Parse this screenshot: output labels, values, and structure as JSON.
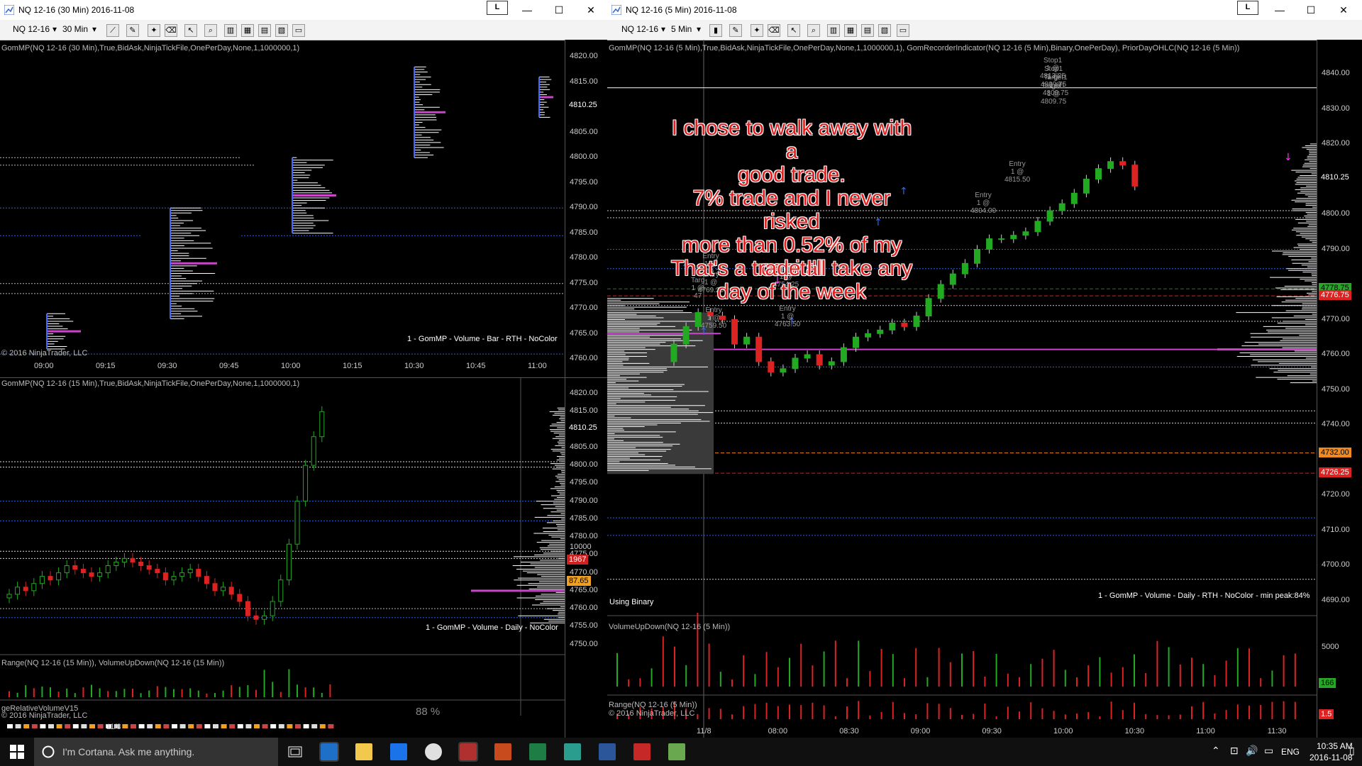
{
  "left_window": {
    "title": "NQ 12-16 (30 Min)  2016-11-08",
    "lock_label": "L",
    "toolbar": {
      "instrument": "NQ 12-16",
      "interval": "30 Min"
    },
    "top_panel": {
      "indicator_text": "GomMP(NQ 12-16 (30 Min),True,BidAsk,NinjaTickFile,OnePerDay,None,1,1000000,1)",
      "legend": "1 - GomMP  - Volume - Bar - RTH - NoColor",
      "copyright": "© 2016 NinjaTrader, LLC",
      "price_ticks": [
        "4820.00",
        "4815.00",
        "4805.00",
        "4800.00",
        "4795.00",
        "4790.00",
        "4785.00",
        "4780.00",
        "4775.00",
        "4770.00",
        "4765.00",
        "4760.00"
      ],
      "last_price": "4810.25",
      "time_ticks": [
        "09:00",
        "09:15",
        "09:30",
        "09:45",
        "10:00",
        "10:15",
        "10:30",
        "10:45",
        "11:00"
      ]
    },
    "bottom_panel": {
      "indicator_text": "GomMP(NQ 12-16 (15 Min),True,BidAsk,NinjaTickFile,OnePerDay,None,1,1000000,1)",
      "legend": "1 - GomMP  - Volume - Daily - NoColor",
      "price_ticks": [
        "4820.00",
        "4815.00",
        "4805.00",
        "4800.00",
        "4795.00",
        "4790.00",
        "4785.00",
        "4780.00",
        "4775.00",
        "4770.00",
        "4765.00",
        "4760.00",
        "4755.00",
        "4750.00"
      ],
      "last_price": "4810.25",
      "volume_label": "Range(NQ 12-16 (15 Min)), VolumeUpDown(NQ 12-16 (15 Min))",
      "volume_tick": "10000",
      "volume_tag": "1967",
      "relvol_label": "geRelativeVolumeV15",
      "relvol_copyright": "© 2016 NinjaTrader, LLC",
      "relvol_pct": "88 %",
      "relvol_tag": "87.65",
      "date_tick": "11/8"
    }
  },
  "right_window": {
    "title": "NQ 12-16 (5 Min)  2016-11-08",
    "lock_label": "L",
    "toolbar": {
      "instrument": "NQ 12-16",
      "interval": "5 Min"
    },
    "main_panel": {
      "indicator_text": "GomMP(NQ 12-16 (5 Min),True,BidAsk,NinjaTickFile,OnePerDay,None,1,1000000,1), GomRecorderIndicator(NQ 12-16 (5 Min),Binary,OnePerDay), PriorDayOHLC(NQ 12-16 (5 Min))",
      "price_ticks": [
        "4840.00",
        "4830.00",
        "4820.00",
        "4810.25",
        "4800.00",
        "4790.00",
        "4778.75",
        "4776.75",
        "4770.00",
        "4760.00",
        "4750.00",
        "4740.00",
        "4732.00",
        "4726.25",
        "4720.00",
        "4710.00",
        "4700.00",
        "4690.00"
      ],
      "last_price": "4810.25",
      "tag_green": "4778.75",
      "tag_red": "4776.75",
      "tag_orange": "4732.00",
      "tag_red2": "4726.25",
      "using_binary": "Using Binary",
      "legend": "1 - GomMP  - Volume - Daily - RTH - NoColor - min peak:84%",
      "trades": [
        {
          "label": "Stop1",
          "price": "1 @ 4813.25"
        },
        {
          "label": "Stop1",
          "price": "1 @ 4809.75"
        },
        {
          "label": "Target1",
          "price": "1 @ 4809.75"
        },
        {
          "label": "Target1",
          "price": "1 @ 4809.75"
        },
        {
          "label": "Entry",
          "price": "1 @ 4815.50"
        },
        {
          "label": "Entry",
          "price": "1 @ 4804.00"
        },
        {
          "label": "Entry",
          "price": "1 @ 4769.25"
        },
        {
          "label": "Stop1",
          "price": "1 @ 4754.25"
        },
        {
          "label": "Entry",
          "price": "1 @ 4759.50"
        },
        {
          "label": "Entry",
          "price": "1 @ 4763.50"
        },
        {
          "label": "Entry",
          "price": "1 @ 4769.25"
        },
        {
          "label": "Targ",
          "price": "1 @ 47"
        }
      ],
      "annotation_1": [
        "I chose to walk away with a",
        "good trade.",
        "7% trade and I never risked",
        "more than 0.52% of my",
        "capital"
      ],
      "annotation_2": [
        "That's a trade I'll take any",
        "day of the week"
      ]
    },
    "volume_panel": {
      "label": "VolumeUpDown(NQ 12-16 (5 Min))",
      "tick": "5000",
      "tag": "166"
    },
    "range_panel": {
      "label": "Range(NQ 12-16 (5 Min))",
      "copyright": "© 2016 NinjaTrader, LLC",
      "tag": "1.5"
    },
    "time_ticks": [
      "11/8",
      "08:00",
      "08:30",
      "09:00",
      "09:30",
      "10:00",
      "10:30",
      "11:00",
      "11:30"
    ]
  },
  "taskbar": {
    "search_placeholder": "I'm Cortana. Ask me anything.",
    "language": "ENG",
    "time": "10:35 AM",
    "date": "2016-11-08",
    "apps": [
      "outlook-icon",
      "file-explorer-icon",
      "edge-icon",
      "chrome-icon",
      "app-icon",
      "powerpoint-icon",
      "excel-icon",
      "tws-icon",
      "word-icon",
      "acrobat-icon",
      "app2-icon"
    ]
  },
  "colors": {
    "bull": "#22aa22",
    "bear": "#dd2222",
    "profile_poc": "#cc44cc",
    "level_blue": "#2a5fd8",
    "annotation": "#e02020"
  }
}
